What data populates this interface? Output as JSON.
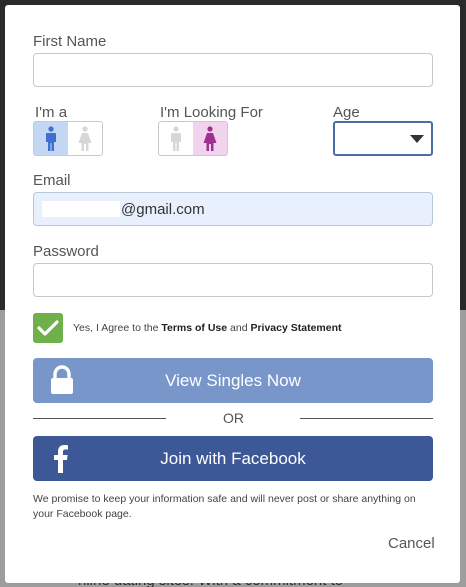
{
  "background": {
    "partial_text": "nline dating sites. With a commitment to"
  },
  "form": {
    "first_name": {
      "label": "First Name",
      "value": ""
    },
    "gender": {
      "label": "I'm a",
      "selected": "male",
      "options": [
        "male-icon",
        "female-icon"
      ]
    },
    "looking_for": {
      "label": "I'm Looking For",
      "selected": "female",
      "options": [
        "male-icon",
        "female-icon"
      ]
    },
    "age": {
      "label": "Age",
      "value": ""
    },
    "email": {
      "label": "Email",
      "value": "@gmail.com"
    },
    "password": {
      "label": "Password",
      "value": ""
    },
    "agree": {
      "checked": true,
      "prefix": "Yes, I Agree to the ",
      "terms": "Terms of Use",
      "middle": " and ",
      "privacy": "Privacy Statement"
    }
  },
  "buttons": {
    "view_singles": "View Singles Now",
    "or": "OR",
    "facebook": "Join with Facebook",
    "cancel": "Cancel"
  },
  "promise_text": "We promise to keep your information safe and will never post or share anything on your Facebook page.",
  "colors": {
    "male_selected": "#c3d6f2",
    "female_selected": "#f1d3ee",
    "male_icon": "#3f6fd1",
    "female_icon": "#a0308f",
    "checkbox": "#6fb04a",
    "singles_button": "#7896c9",
    "facebook_button": "#3c5896"
  },
  "icons": {
    "lock": "lock-icon",
    "facebook": "facebook-icon",
    "check": "checkmark-icon",
    "dropdown": "chevron-down-icon"
  }
}
